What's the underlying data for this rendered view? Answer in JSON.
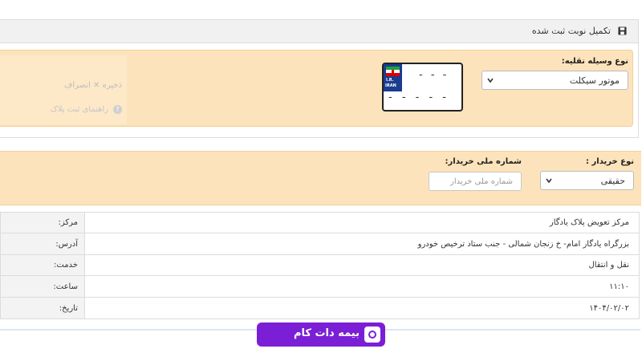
{
  "header": {
    "title": "تکمیل نوبت ثبت شده",
    "save_icon": "save-icon"
  },
  "vehicle": {
    "label": "نوع وسیله نقلیه:",
    "selected": "موتور سیکلت",
    "plate": {
      "country_line1": "I.R.",
      "country_line2": "IRAN",
      "top_digits": "- - -",
      "bottom_digits": "- - - - -"
    },
    "ghost_row1": "ذخیره   ✕   انصراف",
    "ghost_row2": "راهنمای ثبت پلاک"
  },
  "buyer": {
    "type_label": "نوع خریدار :",
    "type_selected": "حقیقی",
    "national_id_label": "شماره ملی خریدار:",
    "national_id_placeholder": "شماره ملی خریدار",
    "national_id_value": ""
  },
  "info": {
    "rows": [
      {
        "key": "مرکز:",
        "value": "مرکز تعویض پلاک یادگار"
      },
      {
        "key": "آدرس:",
        "value": "بزرگراه یادگار امام- خ زنجان شمالی - جنب ستاد ترخیص خودرو"
      },
      {
        "key": "خدمت:",
        "value": "نقل و انتقال"
      },
      {
        "key": "ساعت:",
        "value": "۱۱:۱۰"
      },
      {
        "key": "تاریخ:",
        "value": "۱۴۰۴/۰۲/۰۲"
      }
    ]
  },
  "watermark": {
    "text": "بیمه دات کام"
  },
  "colors": {
    "panel_bg": "#fde3bb",
    "panel_border": "#f2cf96",
    "header_bg": "#f1f1f1",
    "watermark_bg": "#7b1fd6"
  }
}
